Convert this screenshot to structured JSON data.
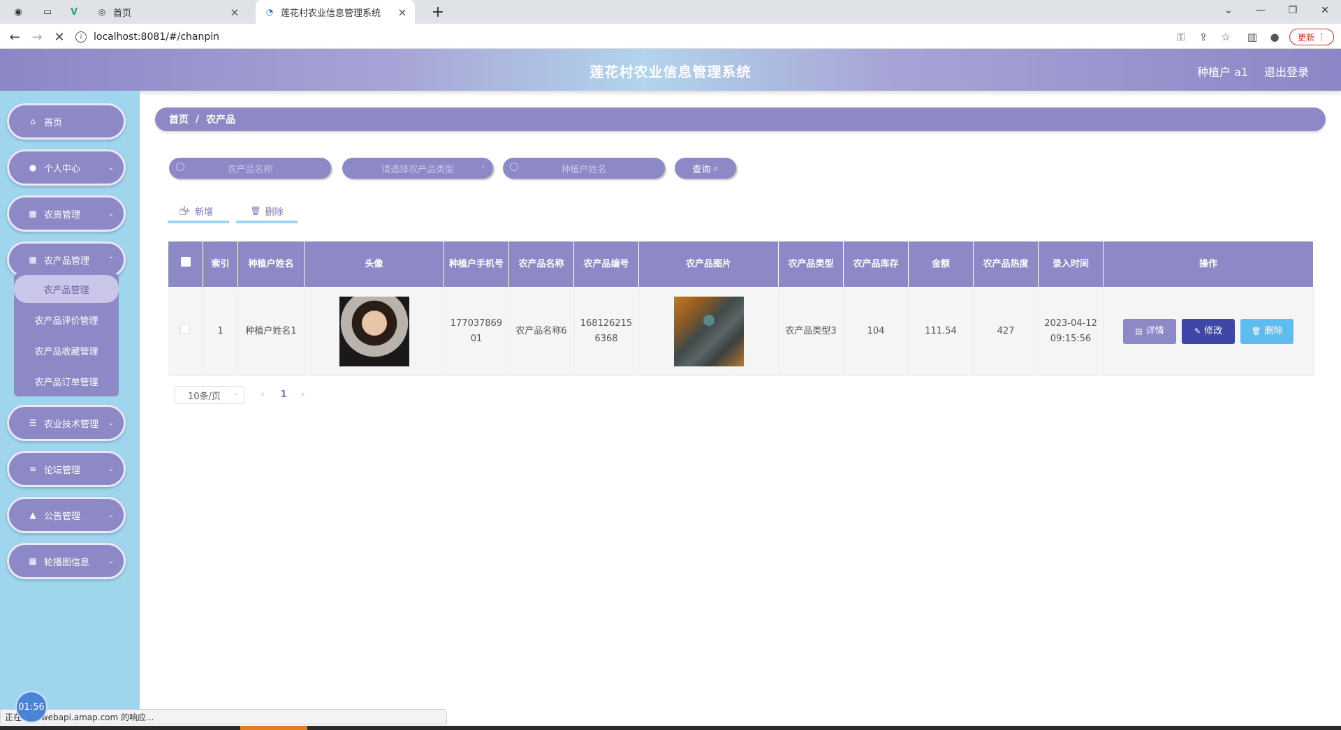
{
  "browser": {
    "tabs": [
      {
        "title": "首页",
        "favicon": "globe-icon"
      },
      {
        "title": "莲花村农业信息管理系统",
        "favicon": "loading-icon"
      }
    ],
    "url": "localhost:8081/#/chanpin",
    "update_label": "更新"
  },
  "header": {
    "title": "莲花村农业信息管理系统",
    "user": "种植户 a1",
    "logout": "退出登录"
  },
  "sidebar": {
    "items": [
      {
        "label": "首页",
        "icon": "home-icon"
      },
      {
        "label": "个人中心",
        "icon": "user-icon"
      },
      {
        "label": "农资管理",
        "icon": "grid-icon"
      },
      {
        "label": "农产品管理",
        "icon": "grid-icon"
      },
      {
        "label": "农业技术管理",
        "icon": "sliders-icon"
      },
      {
        "label": "论坛管理",
        "icon": "list-icon"
      },
      {
        "label": "公告管理",
        "icon": "thumb-icon"
      },
      {
        "label": "轮播图信息",
        "icon": "apps-icon"
      }
    ],
    "submenu": [
      "农产品管理",
      "农产品评价管理",
      "农产品收藏管理",
      "农产品订单管理"
    ]
  },
  "breadcrumb": {
    "home": "首页",
    "current": "农产品"
  },
  "search": {
    "name_placeholder": "农产品名称",
    "type_placeholder": "请选择农产品类型",
    "farmer_placeholder": "种植户姓名",
    "query_label": "查询"
  },
  "actions": {
    "add": "新增",
    "delete": "删除"
  },
  "table": {
    "columns": [
      "索引",
      "种植户姓名",
      "头像",
      "种植户手机号",
      "农产品名称",
      "农产品编号",
      "农产品图片",
      "农产品类型",
      "农产品库存",
      "金额",
      "农产品热度",
      "录入时间",
      "操作"
    ],
    "rows": [
      {
        "index": "1",
        "farmer_name": "种植户姓名1",
        "phone": "17703786901",
        "product_name": "农产品名称6",
        "product_no": "1681262156368",
        "product_type": "农产品类型3",
        "stock": "104",
        "amount": "111.54",
        "heat": "427",
        "entry_time": "2023-04-12 09:15:56"
      }
    ],
    "row_actions": {
      "detail": "详情",
      "edit": "修改",
      "delete": "删除"
    }
  },
  "pagination": {
    "page_size": "10条/页",
    "current_page": "1"
  },
  "status_bar": {
    "text": "正在等待 webapi.amap.com 的响应..."
  },
  "clock": {
    "time": "01:56"
  }
}
